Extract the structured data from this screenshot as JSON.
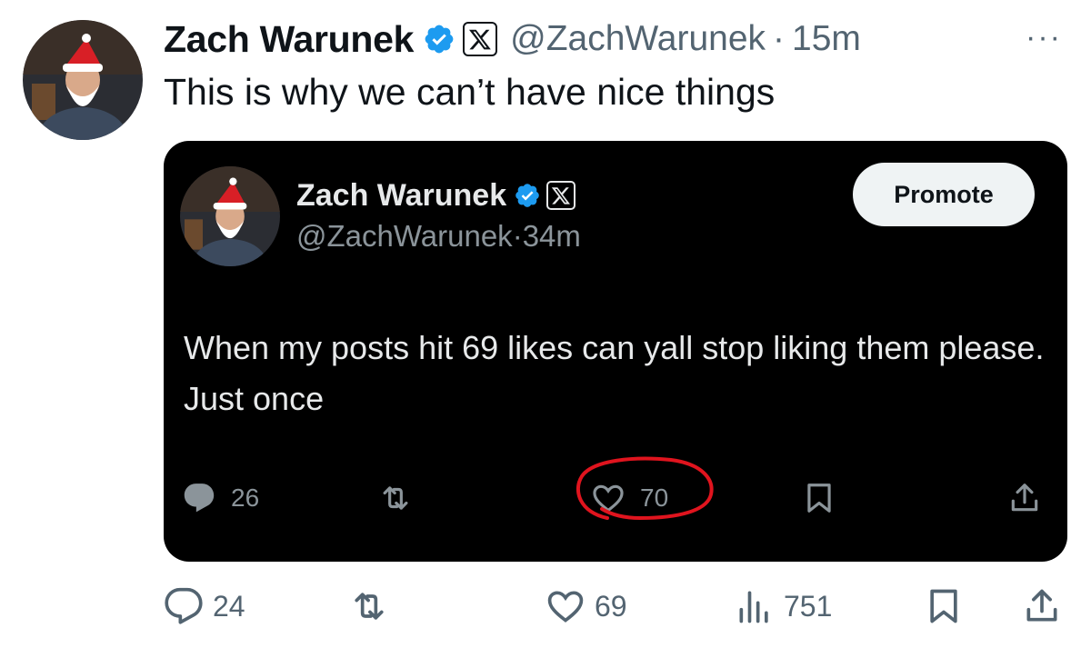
{
  "outer_tweet": {
    "author_name": "Zach Warunek",
    "handle": "@ZachWarunek",
    "separator": "·",
    "time": "15m",
    "more_menu": "···",
    "text": "This is why we can’t have nice things",
    "actions": {
      "replies": "24",
      "likes": "69",
      "views": "751"
    }
  },
  "quoted_screenshot": {
    "author_name": "Zach Warunek",
    "handle": "@ZachWarunek",
    "separator": "·",
    "time": "34m",
    "promote_label": "Promote",
    "text": "When my posts hit 69 likes can yall stop liking them please. Just once",
    "actions": {
      "replies": "26",
      "likes": "70"
    }
  },
  "colors": {
    "verified_blue": "#1d9bf0",
    "muted_text": "#536471",
    "circle_annotation": "#e0141e",
    "dark_bg": "#000000"
  },
  "icons": [
    "verified-icon",
    "x-logo-icon",
    "reply-icon",
    "retweet-icon",
    "heart-icon",
    "views-icon",
    "bookmark-icon",
    "share-icon"
  ]
}
